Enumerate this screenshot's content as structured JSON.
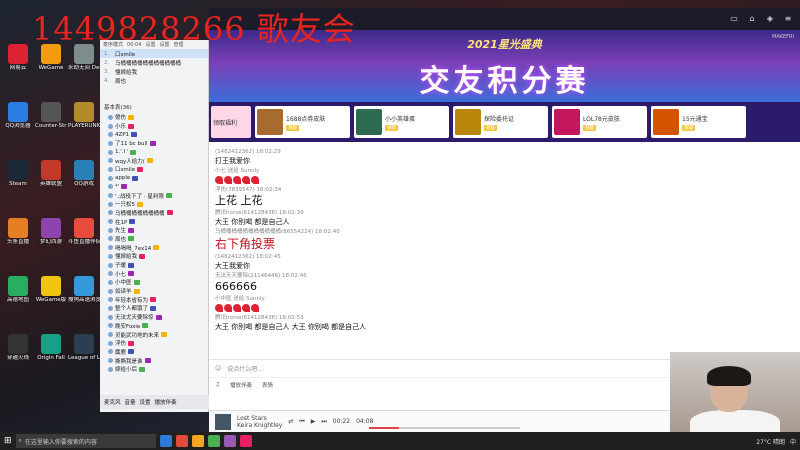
{
  "overlay_title": "1449828266 歌友会",
  "desktop_icons": [
    {
      "label": "网易云",
      "icon": "app-icon"
    },
    {
      "label": "QQ浏览器",
      "icon": "browser-icon"
    },
    {
      "label": "Steam",
      "icon": "steam-icon"
    },
    {
      "label": "头条直播",
      "icon": "app-icon"
    },
    {
      "label": "高德地图",
      "icon": "map-icon"
    },
    {
      "label": "穿越火线",
      "icon": "game-icon"
    },
    {
      "label": "WeGame",
      "icon": "app-icon"
    },
    {
      "label": "Counter-Strike Global Off",
      "icon": "game-icon"
    },
    {
      "label": "英雄联盟",
      "icon": "game-icon"
    },
    {
      "label": "梦幻西游",
      "icon": "game-icon"
    },
    {
      "label": "WeGame版",
      "icon": "app-icon"
    },
    {
      "label": "Origin Fall",
      "icon": "game-icon"
    },
    {
      "label": "永劫无间 Demo",
      "icon": "game-icon"
    },
    {
      "label": "PLAYERUNKNOWN'S BATTLEGRO",
      "icon": "game-icon"
    },
    {
      "label": "QQ游戏",
      "icon": "game-icon"
    },
    {
      "label": "斗鱼直播伴侣",
      "icon": "app-icon"
    },
    {
      "label": "搜狗高速浏览器",
      "icon": "browser-icon"
    },
    {
      "label": "League of Legends",
      "icon": "game-icon"
    },
    {
      "label": "新建文本文档(3)",
      "icon": "file-icon"
    },
    {
      "label": "网易UU加速器",
      "icon": "app-icon"
    },
    {
      "label": "Google Chrome",
      "icon": "chrome-icon"
    },
    {
      "label": "League of...",
      "icon": "game-icon"
    },
    {
      "label": "YY语音",
      "icon": "app-icon"
    }
  ],
  "left_panel": {
    "header_items": [
      "麦序模式",
      "00:04",
      "设置",
      "设置",
      "管理"
    ],
    "songs": [
      {
        "n": "1.",
        "title": "口smile"
      },
      {
        "n": "2.",
        "title": "马桶桶桶桶桶桶桶桶桶桶桶"
      },
      {
        "n": "3.",
        "title": "懂嫁给我"
      },
      {
        "n": "4.",
        "title": "周也"
      }
    ],
    "section_title": "基本表(36)",
    "users": [
      "傻伤",
      "小乐",
      "4ZP1",
      "了11 bc bull",
      "1.'.I '",
      "wqy人给力(",
      "口smile",
      "apple",
      "*'",
      "'.;战役下了 · 星利限",
      "一只松5",
      "马桶桶桶桶桶桶桶桶",
      "在1P",
      "先生",
      "周也",
      "喝喝喝_7ex14",
      "懂嫁给我",
      "子暖",
      "小七",
      "小中医",
      "如读羊",
      "年轻本省有为",
      "整个人都饿了",
      "无法尤天要除惊",
      "晚安Foxie",
      "灵能武功地的未来",
      "浮伤",
      "麋鹿",
      "撕撕我是谁",
      "嫁给小后"
    ],
    "toolbar": [
      "麦克风",
      "音量",
      "设置",
      "播放伴奏"
    ]
  },
  "banner": {
    "sub": "2021星光盛典",
    "main": "交友积分赛",
    "right_tag": "MAKEFRI"
  },
  "gifts": [
    {
      "name": "1688点券皮肤",
      "tag": "领取"
    },
    {
      "name": "小小英雄蛋",
      "tag": "领取"
    },
    {
      "name": "探险委托证",
      "tag": "领取"
    },
    {
      "name": "LOL78元皮肤",
      "tag": "领取"
    },
    {
      "name": "15元通宝",
      "tag": "领取"
    }
  ],
  "gift_first_label": "领取福利",
  "chat": [
    {
      "meta": "(1482412362) 18:02:29",
      "body": "打王我爱你",
      "style": ""
    },
    {
      "meta": "小七 送给 Sunnly",
      "body": "",
      "style": "flowers",
      "count": 5
    },
    {
      "meta": "浮伤(7839547) 18:02:34",
      "body": "上花 上花",
      "style": "big"
    },
    {
      "meta": "腾讯horse(614128438) 18:02:39",
      "body": "大王 你别喝 都是自己人",
      "style": ""
    },
    {
      "meta": "马桶桶桶桶桶桶桶桶桶桶桶(86554224) 18:02:40",
      "body": "右下角投票",
      "style": "red"
    },
    {
      "meta": "(1482412362) 18:02:45",
      "body": "大王我爱你",
      "style": ""
    },
    {
      "meta": "无法无天要除(21146446) 18:02:46",
      "body": "666666",
      "style": "big"
    },
    {
      "meta": "小中医 送给 Sunnly",
      "body": "",
      "style": "flowers",
      "count": 5
    },
    {
      "meta": "腾讯horse(614128438) 18:02:53",
      "body": "大王 你别喝 都是自己人    大王 你别喝 都是自己人",
      "style": ""
    }
  ],
  "chat_input_placeholder": "说点什么吧...",
  "chat_tools": [
    "播放伴奏",
    "表情"
  ],
  "player": {
    "title": "Lost Stars",
    "artist": "Keira Knightley",
    "time_cur": "00:22",
    "time_total": "04:08",
    "progress": 0.2
  },
  "taskbar": {
    "search_placeholder": "在这里输入你要搜索的内容",
    "weather": "27°C 晴朗",
    "lang": "中"
  }
}
